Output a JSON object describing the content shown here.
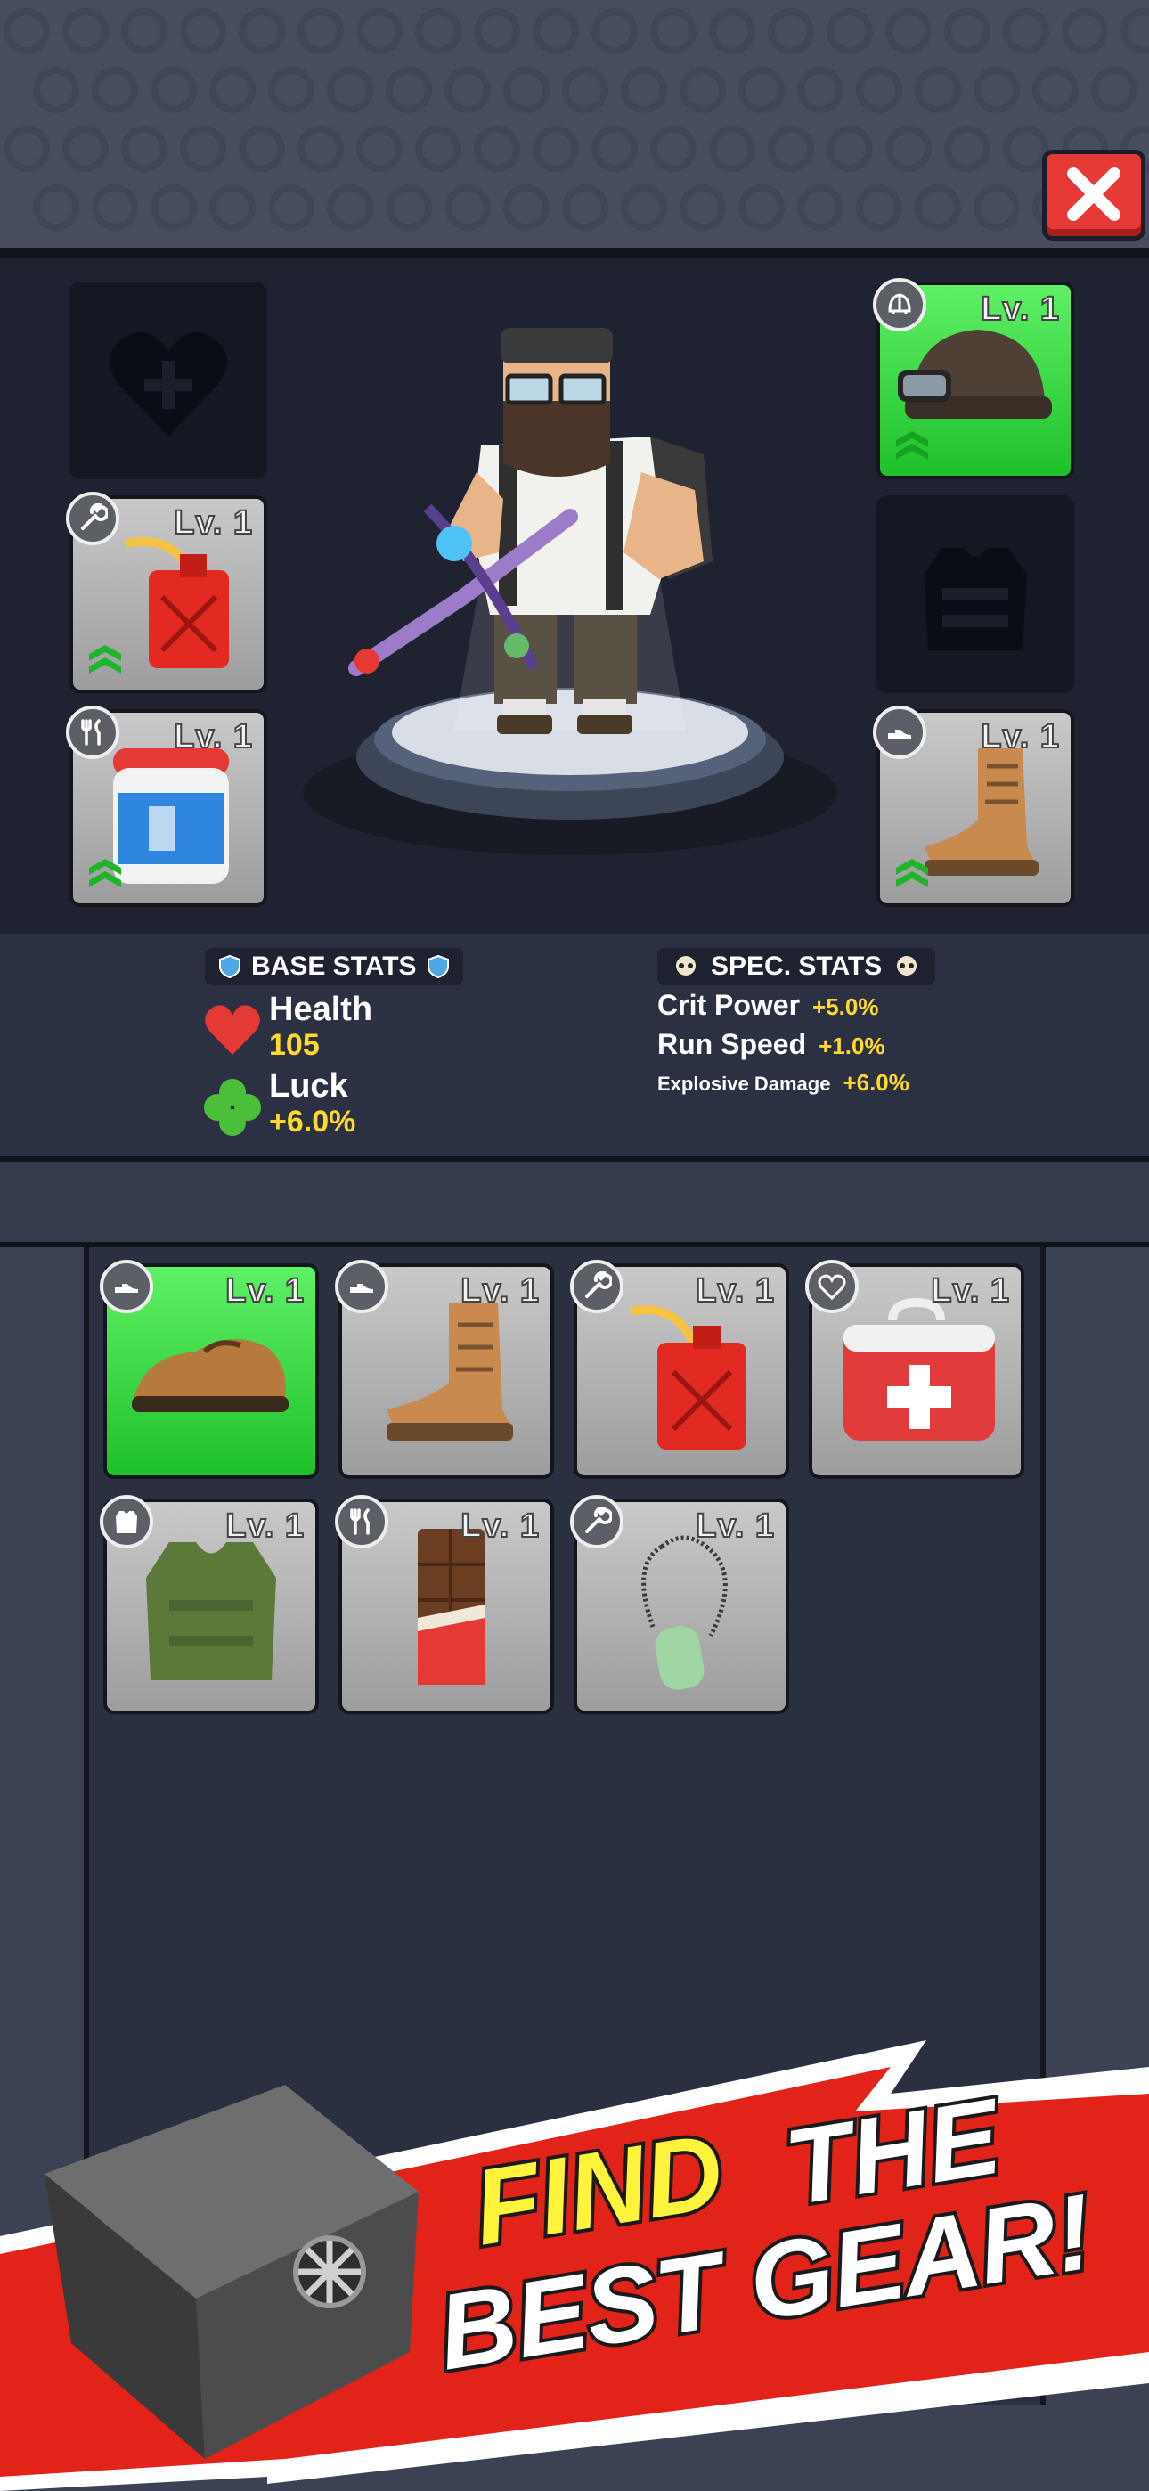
{
  "close_button": {
    "icon": "close-icon"
  },
  "equipped": {
    "left": [
      {
        "slot": "health",
        "empty": true,
        "icon": "heart-plus-icon"
      },
      {
        "slot": "tool",
        "level": "Lv. 1",
        "icon": "wrench-icon",
        "item": "fuel-can"
      },
      {
        "slot": "food",
        "level": "Lv. 1",
        "icon": "fork-knife-icon",
        "item": "jar"
      }
    ],
    "right": [
      {
        "slot": "head",
        "level": "Lv. 1",
        "icon": "helmet-icon",
        "item": "helmet-goggles",
        "rarity": "green"
      },
      {
        "slot": "body",
        "empty": true,
        "icon": "vest-icon"
      },
      {
        "slot": "feet",
        "level": "Lv. 1",
        "icon": "shoe-icon",
        "item": "boot"
      }
    ]
  },
  "base_stats": {
    "title": "BASE STATS",
    "health_label": "Health",
    "health_value": "105",
    "luck_label": "Luck",
    "luck_value": "+6.0%"
  },
  "spec_stats": {
    "title": "SPEC. STATS",
    "rows": [
      {
        "name": "Crit Power",
        "value": "+5.0%"
      },
      {
        "name": "Run Speed",
        "value": "+1.0%"
      },
      {
        "name": "Explosive Damage",
        "value": "+6.0%"
      }
    ]
  },
  "inventory": [
    {
      "level": "Lv. 1",
      "icon": "shoe-icon",
      "item": "brown-shoe",
      "rarity": "green"
    },
    {
      "level": "Lv. 1",
      "icon": "shoe-icon",
      "item": "boot"
    },
    {
      "level": "Lv. 1",
      "icon": "wrench-icon",
      "item": "fuel-can"
    },
    {
      "level": "Lv. 1",
      "icon": "heart-plus-icon",
      "item": "first-aid-kit"
    },
    {
      "level": "Lv. 1",
      "icon": "vest-icon",
      "item": "green-vest"
    },
    {
      "level": "Lv. 1",
      "icon": "fork-knife-icon",
      "item": "chocolate-bar"
    },
    {
      "level": "Lv. 1",
      "icon": "wrench-icon",
      "item": "dog-tag"
    }
  ],
  "banner": {
    "line1_a": "FIND",
    "line1_b": "THE",
    "line2": "BEST GEAR!"
  },
  "colors": {
    "accent_green": "#28d234",
    "yellow": "#ffd92b",
    "banner_red": "#e2231a"
  }
}
